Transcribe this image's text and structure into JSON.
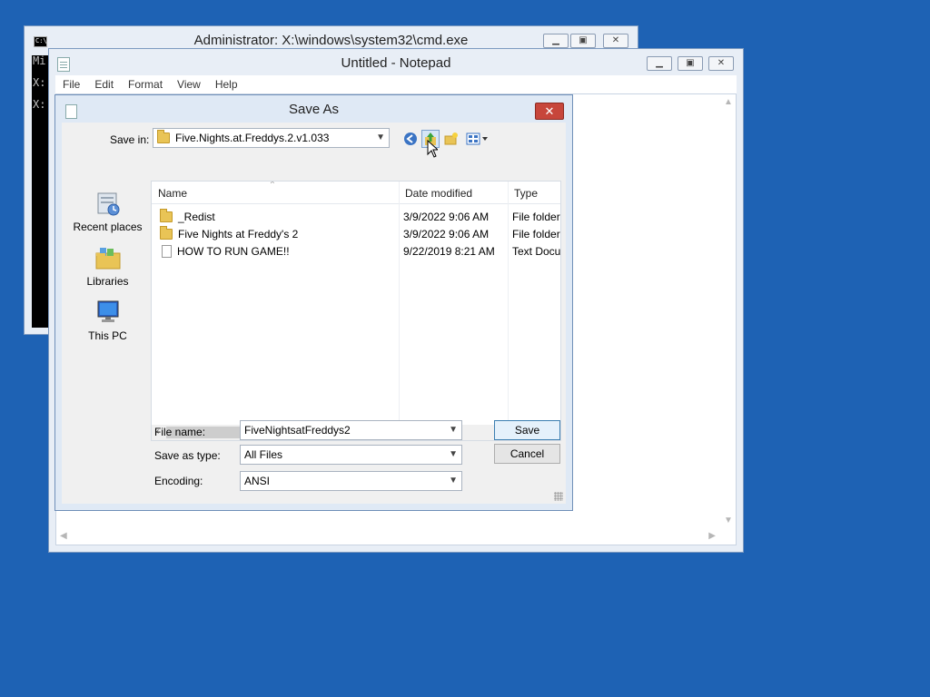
{
  "cmd": {
    "title": "Administrator: X:\\windows\\system32\\cmd.exe",
    "icon_text": "C:\\",
    "lines": [
      "Mi",
      "",
      "X:",
      "",
      "X:"
    ]
  },
  "notepad": {
    "title": "Untitled - Notepad",
    "menu": [
      "File",
      "Edit",
      "Format",
      "View",
      "Help"
    ]
  },
  "dialog": {
    "title": "Save As",
    "close_glyph": "✕",
    "save_in_label": "Save in:",
    "save_in_value": "Five.Nights.at.Freddys.2.v1.033",
    "places": [
      {
        "label": "Recent places",
        "icon": "recent-places-icon"
      },
      {
        "label": "Libraries",
        "icon": "libraries-icon"
      },
      {
        "label": "This PC",
        "icon": "this-pc-icon"
      }
    ],
    "columns": [
      "Name",
      "Date modified",
      "Type"
    ],
    "files": [
      {
        "name": "_Redist",
        "date": "3/9/2022 9:06 AM",
        "type": "File folder",
        "icon": "folder-icon"
      },
      {
        "name": "Five Nights at Freddy's 2",
        "date": "3/9/2022 9:06 AM",
        "type": "File folder",
        "icon": "folder-icon"
      },
      {
        "name": "HOW TO RUN GAME!!",
        "date": "9/22/2019 8:21 AM",
        "type": "Text Docu",
        "icon": "text-document-icon"
      }
    ],
    "file_name_label": "File name:",
    "file_name_value": "FiveNightsatFreddys2",
    "save_type_label": "Save as type:",
    "save_type_value": "All Files",
    "encoding_label": "Encoding:",
    "encoding_value": "ANSI",
    "save_button": "Save",
    "cancel_button": "Cancel"
  }
}
